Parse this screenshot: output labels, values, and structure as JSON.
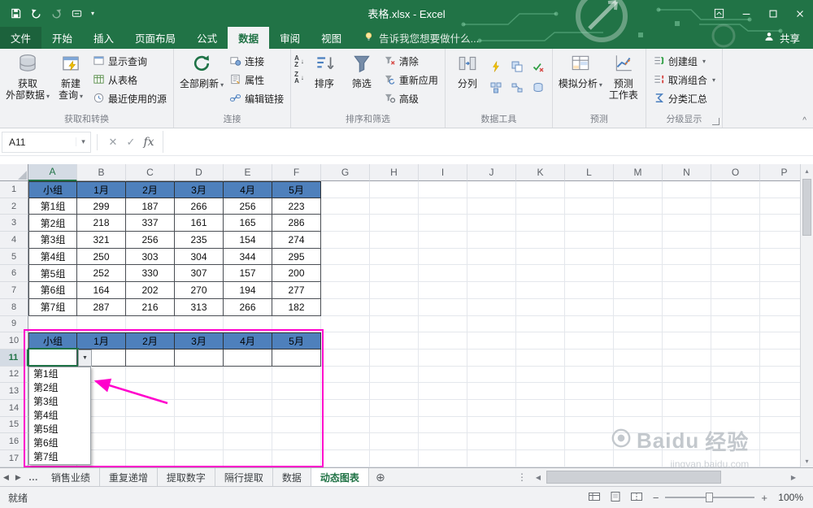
{
  "titlebar": {
    "title": "表格.xlsx - Excel"
  },
  "tabrow": {
    "file": "文件",
    "tabs": [
      "开始",
      "插入",
      "页面布局",
      "公式",
      "数据",
      "审阅",
      "视图"
    ],
    "active": "数据",
    "tell_me": "告诉我您想要做什么...",
    "share": "共享"
  },
  "ribbon": {
    "get_external": "获取\n外部数据",
    "new_query": "新建\n查询",
    "show_queries": "显示查询",
    "from_table": "从表格",
    "recent_sources": "最近使用的源",
    "grp_get": "获取和转换",
    "refresh_all": "全部刷新",
    "connections": "连接",
    "properties": "属性",
    "edit_links": "编辑链接",
    "grp_conn": "连接",
    "sort": "排序",
    "filter": "筛选",
    "clear": "清除",
    "reapply": "重新应用",
    "advanced": "高级",
    "grp_sort": "排序和筛选",
    "text_to_columns": "分列",
    "grp_tools": "数据工具",
    "what_if": "模拟分析",
    "forecast_sheet": "预测\n工作表",
    "grp_forecast": "预测",
    "group": "创建组",
    "ungroup": "取消组合",
    "subtotal": "分类汇总",
    "grp_outline": "分级显示"
  },
  "formula_bar": {
    "name_box": "A11",
    "fx": "fx"
  },
  "grid": {
    "col_headers": [
      "A",
      "B",
      "C",
      "D",
      "E",
      "F",
      "G",
      "H",
      "I",
      "J",
      "K",
      "L",
      "M",
      "N",
      "O",
      "P"
    ],
    "row_count": 17,
    "header_row": [
      "小组",
      "1月",
      "2月",
      "3月",
      "4月",
      "5月"
    ],
    "data_rows": [
      [
        "第1组",
        "299",
        "187",
        "266",
        "256",
        "223"
      ],
      [
        "第2组",
        "218",
        "337",
        "161",
        "165",
        "286"
      ],
      [
        "第3组",
        "321",
        "256",
        "235",
        "154",
        "274"
      ],
      [
        "第4组",
        "250",
        "303",
        "304",
        "344",
        "295"
      ],
      [
        "第5组",
        "252",
        "330",
        "307",
        "157",
        "200"
      ],
      [
        "第6组",
        "164",
        "202",
        "270",
        "194",
        "277"
      ],
      [
        "第7组",
        "287",
        "216",
        "313",
        "266",
        "182"
      ]
    ],
    "second_header_row": [
      "小组",
      "1月",
      "2月",
      "3月",
      "4月",
      "5月"
    ],
    "dropdown_items": [
      "第1组",
      "第2组",
      "第3组",
      "第4组",
      "第5组",
      "第6组",
      "第7组"
    ],
    "selected_cell": "A11"
  },
  "sheetbar": {
    "tabs": [
      "销售业绩",
      "重复递增",
      "提取数字",
      "隔行提取",
      "数据",
      "动态图表"
    ],
    "active": "动态图表"
  },
  "statusbar": {
    "ready": "就绪",
    "zoom": "100%"
  },
  "watermark": {
    "brand": "Baidu",
    "brand2": "经验",
    "url": "jingyan.baidu.com"
  },
  "icons": {
    "caret_down": "▾",
    "dropdown_arrow": "▼",
    "scroll_up": "▴",
    "scroll_down": "▾",
    "scroll_left": "◀",
    "scroll_right": "▶",
    "add_sheet": "⊕",
    "ellipsis": "…",
    "vdots": "⋮",
    "cancel": "✕",
    "enter": "✓",
    "minus": "−",
    "plus": "+",
    "collapse_ribbon": "^",
    "letter_a": "A",
    "letter_z": "Z",
    "down_arrow": "↓"
  },
  "colors": {
    "excel_green": "#217346",
    "table_header_blue": "#4E80BC",
    "highlight_magenta": "#FF00CC"
  }
}
